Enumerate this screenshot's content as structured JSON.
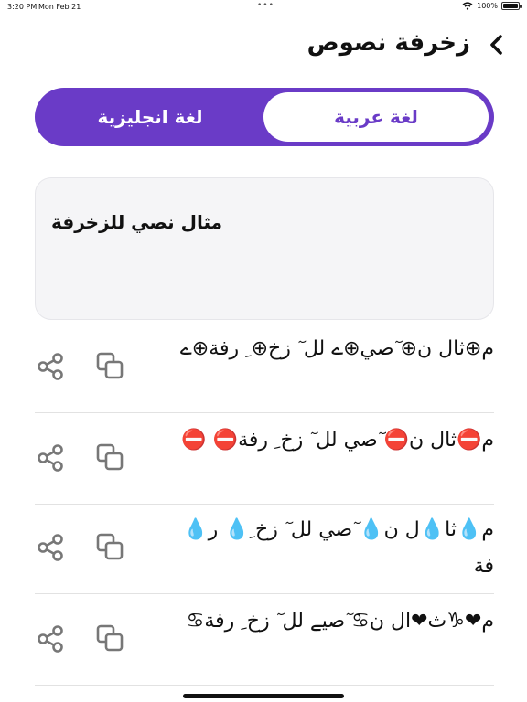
{
  "status": {
    "time": "3:20 PM",
    "date": "Mon Feb 21",
    "battery": "100%",
    "battery_level": 1.0
  },
  "header": {
    "title": "زخرفة نصوص",
    "back_icon": "chevron-left-icon"
  },
  "tabs": [
    {
      "label": "لغة انجليزية",
      "selected": false
    },
    {
      "label": "لغة عربية",
      "selected": true
    }
  ],
  "input": {
    "value": "مثال نصي للزخرفة"
  },
  "results": [
    {
      "text": "م⊕ثال ن⊕ ٓصي⊕ے لل ٓ زخ⊕ ِ رفة⊕ے"
    },
    {
      "text": "م⛔ثال ن⛔ ٓصي لل ٓ زخ ِ رفة⛔ ⛔"
    },
    {
      "text": "م💧ثا💧ل ن💧 ٓصي لل ٓ زخ ِ💧 ر💧فة"
    },
    {
      "text": "م❤♑ث❤ال ن♋ ٓصيے لل ٓ زخ ِ رفة♋"
    }
  ],
  "icons": {
    "copy": "copy-icon",
    "share": "share-icon"
  },
  "colors": {
    "accent": "#6a3bc7",
    "card": "#f5f5f7",
    "icon": "#777777"
  }
}
